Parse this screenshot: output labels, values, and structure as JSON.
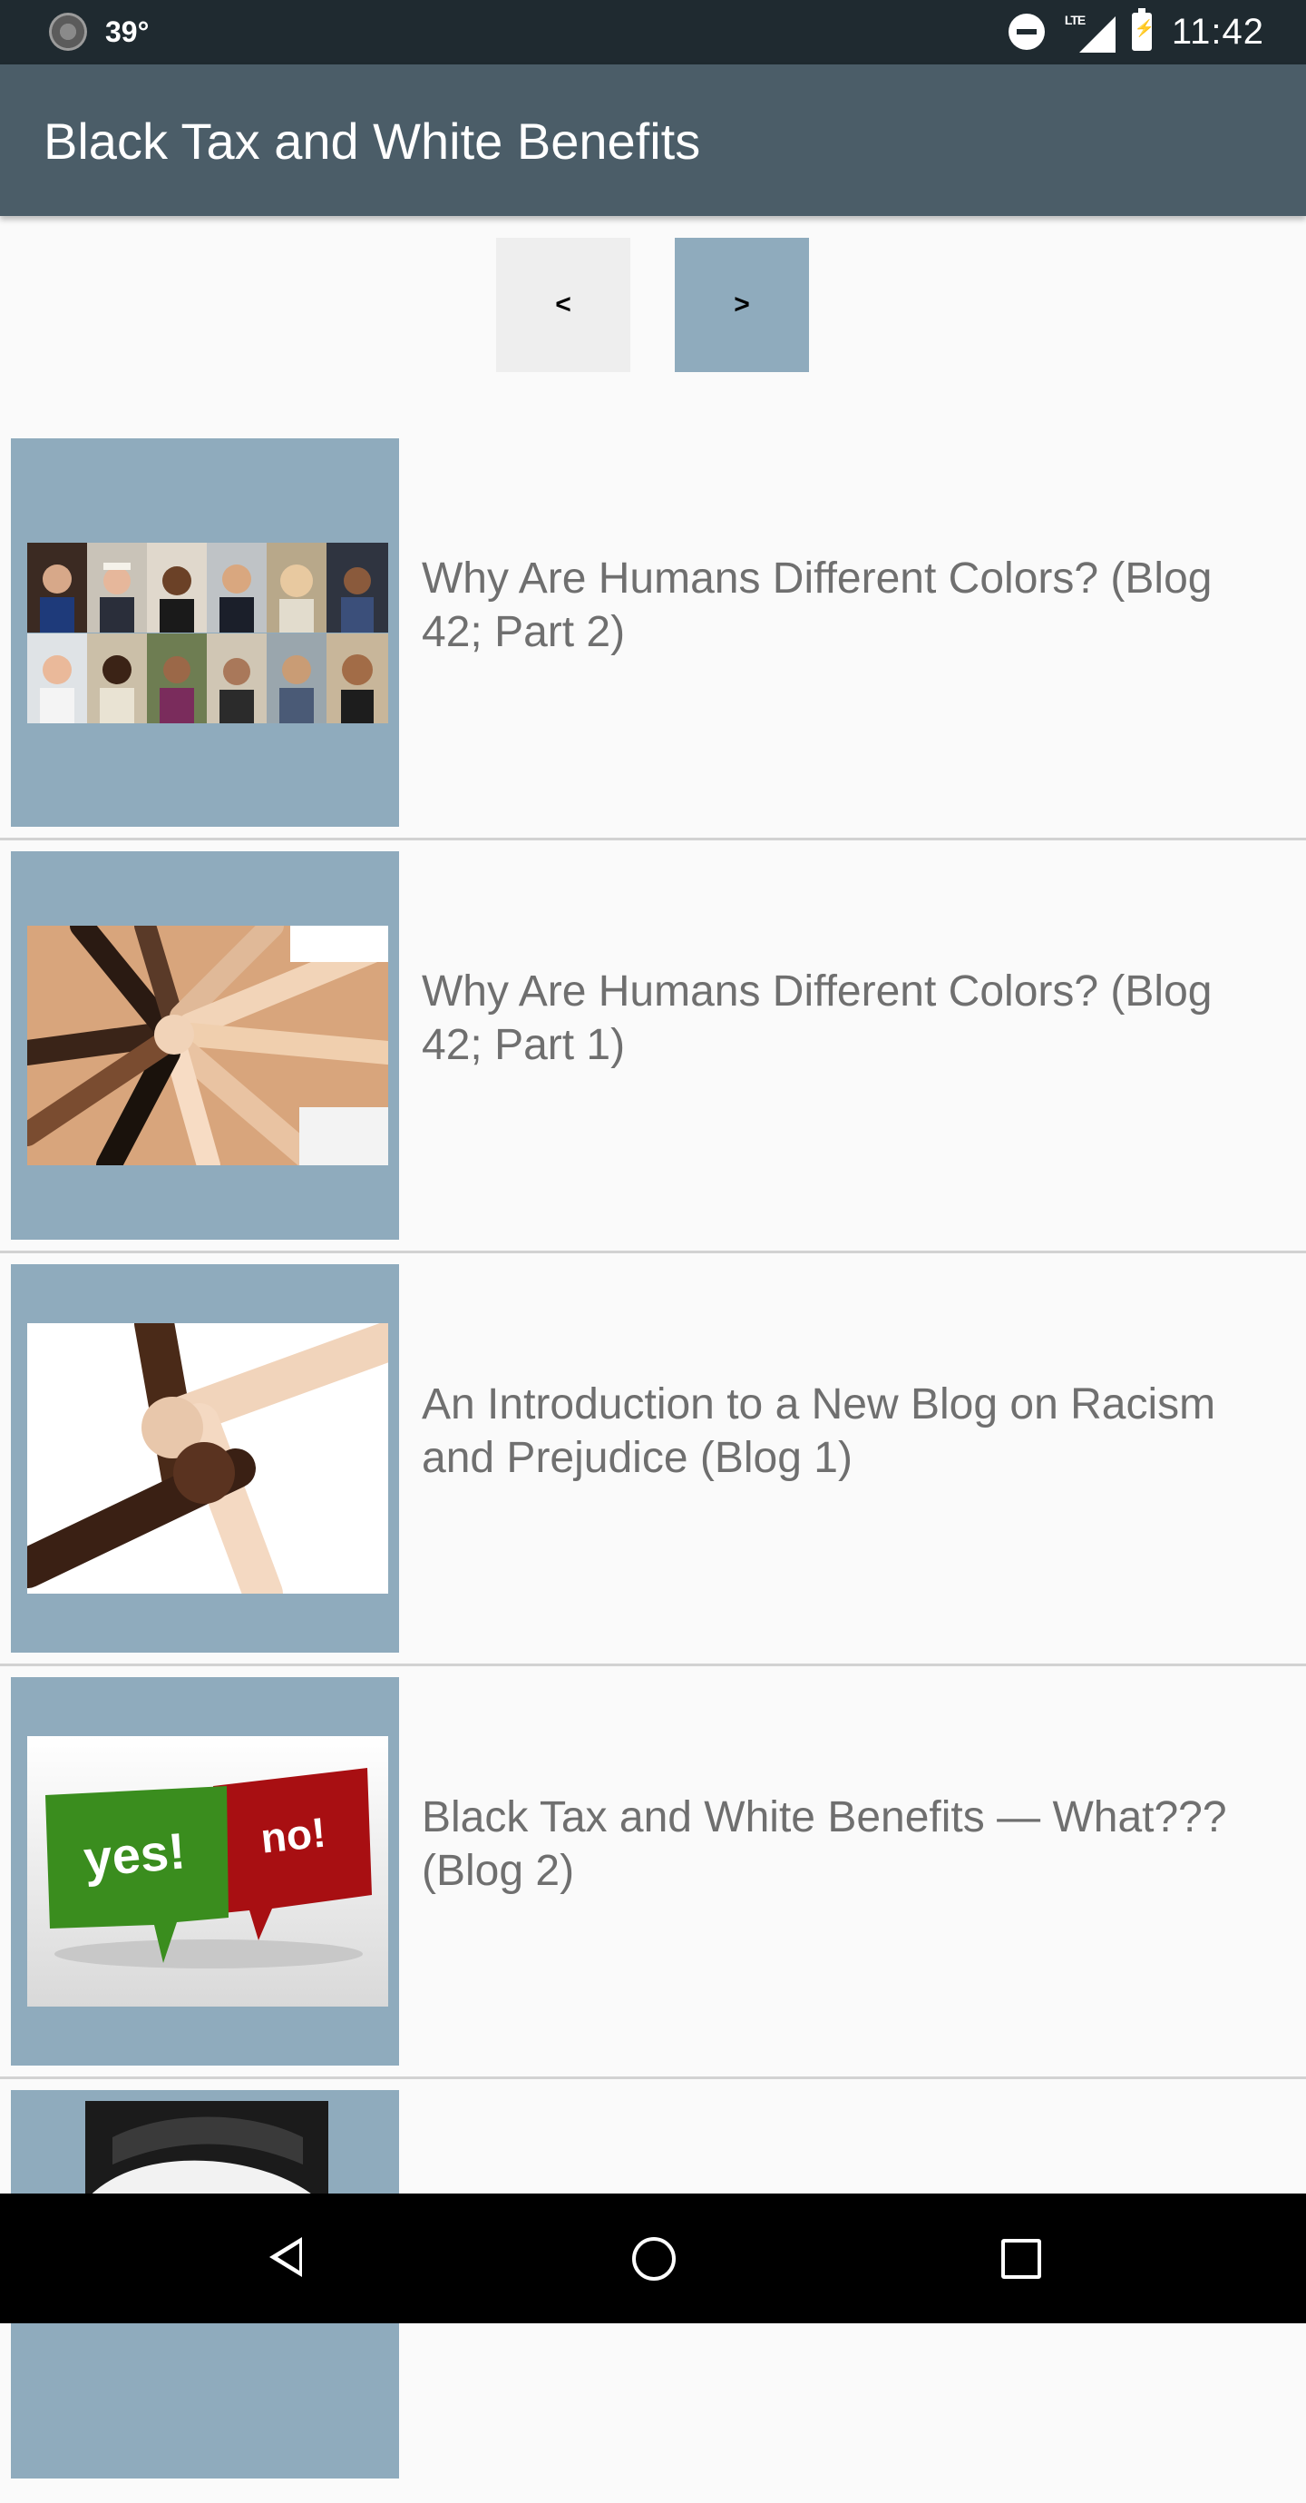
{
  "status_bar": {
    "temperature": "39°",
    "time": "11:42",
    "icons": [
      "weather-icon",
      "do-not-disturb-icon",
      "lte-signal-icon",
      "battery-charging-icon"
    ],
    "network_label": "LTE"
  },
  "app_bar": {
    "title": "Black Tax and White Benefits"
  },
  "pager": {
    "prev_label": "<",
    "next_label": ">"
  },
  "posts": [
    {
      "title": "Why Are Humans Different Colors? (Blog 42; Part 2)",
      "image": "diverse-faces-collage"
    },
    {
      "title": "Why Are Humans Different Colors? (Blog 42; Part 1)",
      "image": "stacked-hands"
    },
    {
      "title": "An Introduction to a New Blog on Racism and Prejudice (Blog 1)",
      "image": "interlocked-hands"
    },
    {
      "title": "Black Tax and White Benefits — What??? (Blog 2)",
      "image": "yes-no-speech-bubbles"
    },
    {
      "title": "",
      "image": "man-portrait-bw"
    }
  ],
  "yes_no_image": {
    "yes": "yes!",
    "no": "no!"
  },
  "colors": {
    "status_bar": "#1f2a30",
    "app_bar": "#4b5d68",
    "thumb_bg": "#8fabbd",
    "next_button": "#8fabbd",
    "prev_button": "#eeeeee"
  }
}
